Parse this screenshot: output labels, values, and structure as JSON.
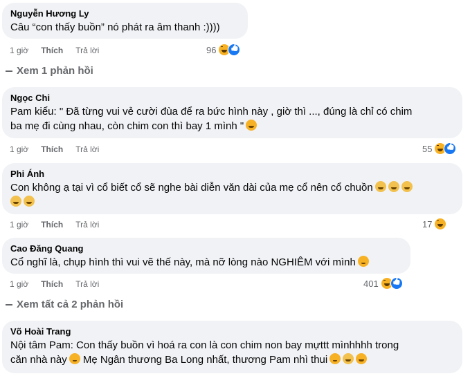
{
  "comments": [
    {
      "name": "Nguyễn Hương Ly",
      "text": "Câu “con thấy buồn” nó phát ra âm thanh :))))",
      "time": "1 giờ",
      "like": "Thích",
      "reply": "Trả lời",
      "count": "96"
    },
    {
      "name": "Ngọc Chi",
      "text1": "Pam kiểu: \" Đã từng vui vẻ cười đùa để ra bức hình này , giờ thì ..., đúng là chỉ có chim",
      "text2": "ba mẹ đi cùng nhau, còn chim con thì bay 1 mình \"",
      "time": "1 giờ",
      "like": "Thích",
      "reply": "Trả lời",
      "count": "55"
    },
    {
      "name": "Phi Ánh",
      "text": "Con không ạ tại vì cổ biết cổ sẽ nghe bài diễn văn dài của mẹ cổ nên cổ chuồn",
      "time": "1 giờ",
      "like": "Thích",
      "reply": "Trả lời",
      "count": "17"
    },
    {
      "name": "Cao Đăng Quang",
      "text": "Cổ nghĩ là, chụp hình thì vui vẽ thế này, mà nỡ lòng nào NGHIÊM với mình",
      "time": "1 giờ",
      "like": "Thích",
      "reply": "Trả lời",
      "count": "401"
    },
    {
      "name": "Võ Hoài Trang",
      "text1": "Nội tâm Pam: Con thấy buồn vì hoá ra con là con chim non bay mựttt mìnhhhh trong",
      "text2": "căn nhà này",
      "text3": "Mẹ Ngân thương Ba Long nhất, thương Pam nhì thui"
    }
  ],
  "replies": {
    "first": "Xem 1 phản hồi",
    "second": "Xem tất cả 2 phản hồi"
  },
  "icons": {
    "haha": "haha-reaction-icon",
    "like": "like-reaction-icon"
  },
  "colors": {
    "bubble": "#f0f2f5",
    "meta": "#65676b",
    "like_blue": "#1877f2",
    "haha_yellow": "#f7b125"
  }
}
